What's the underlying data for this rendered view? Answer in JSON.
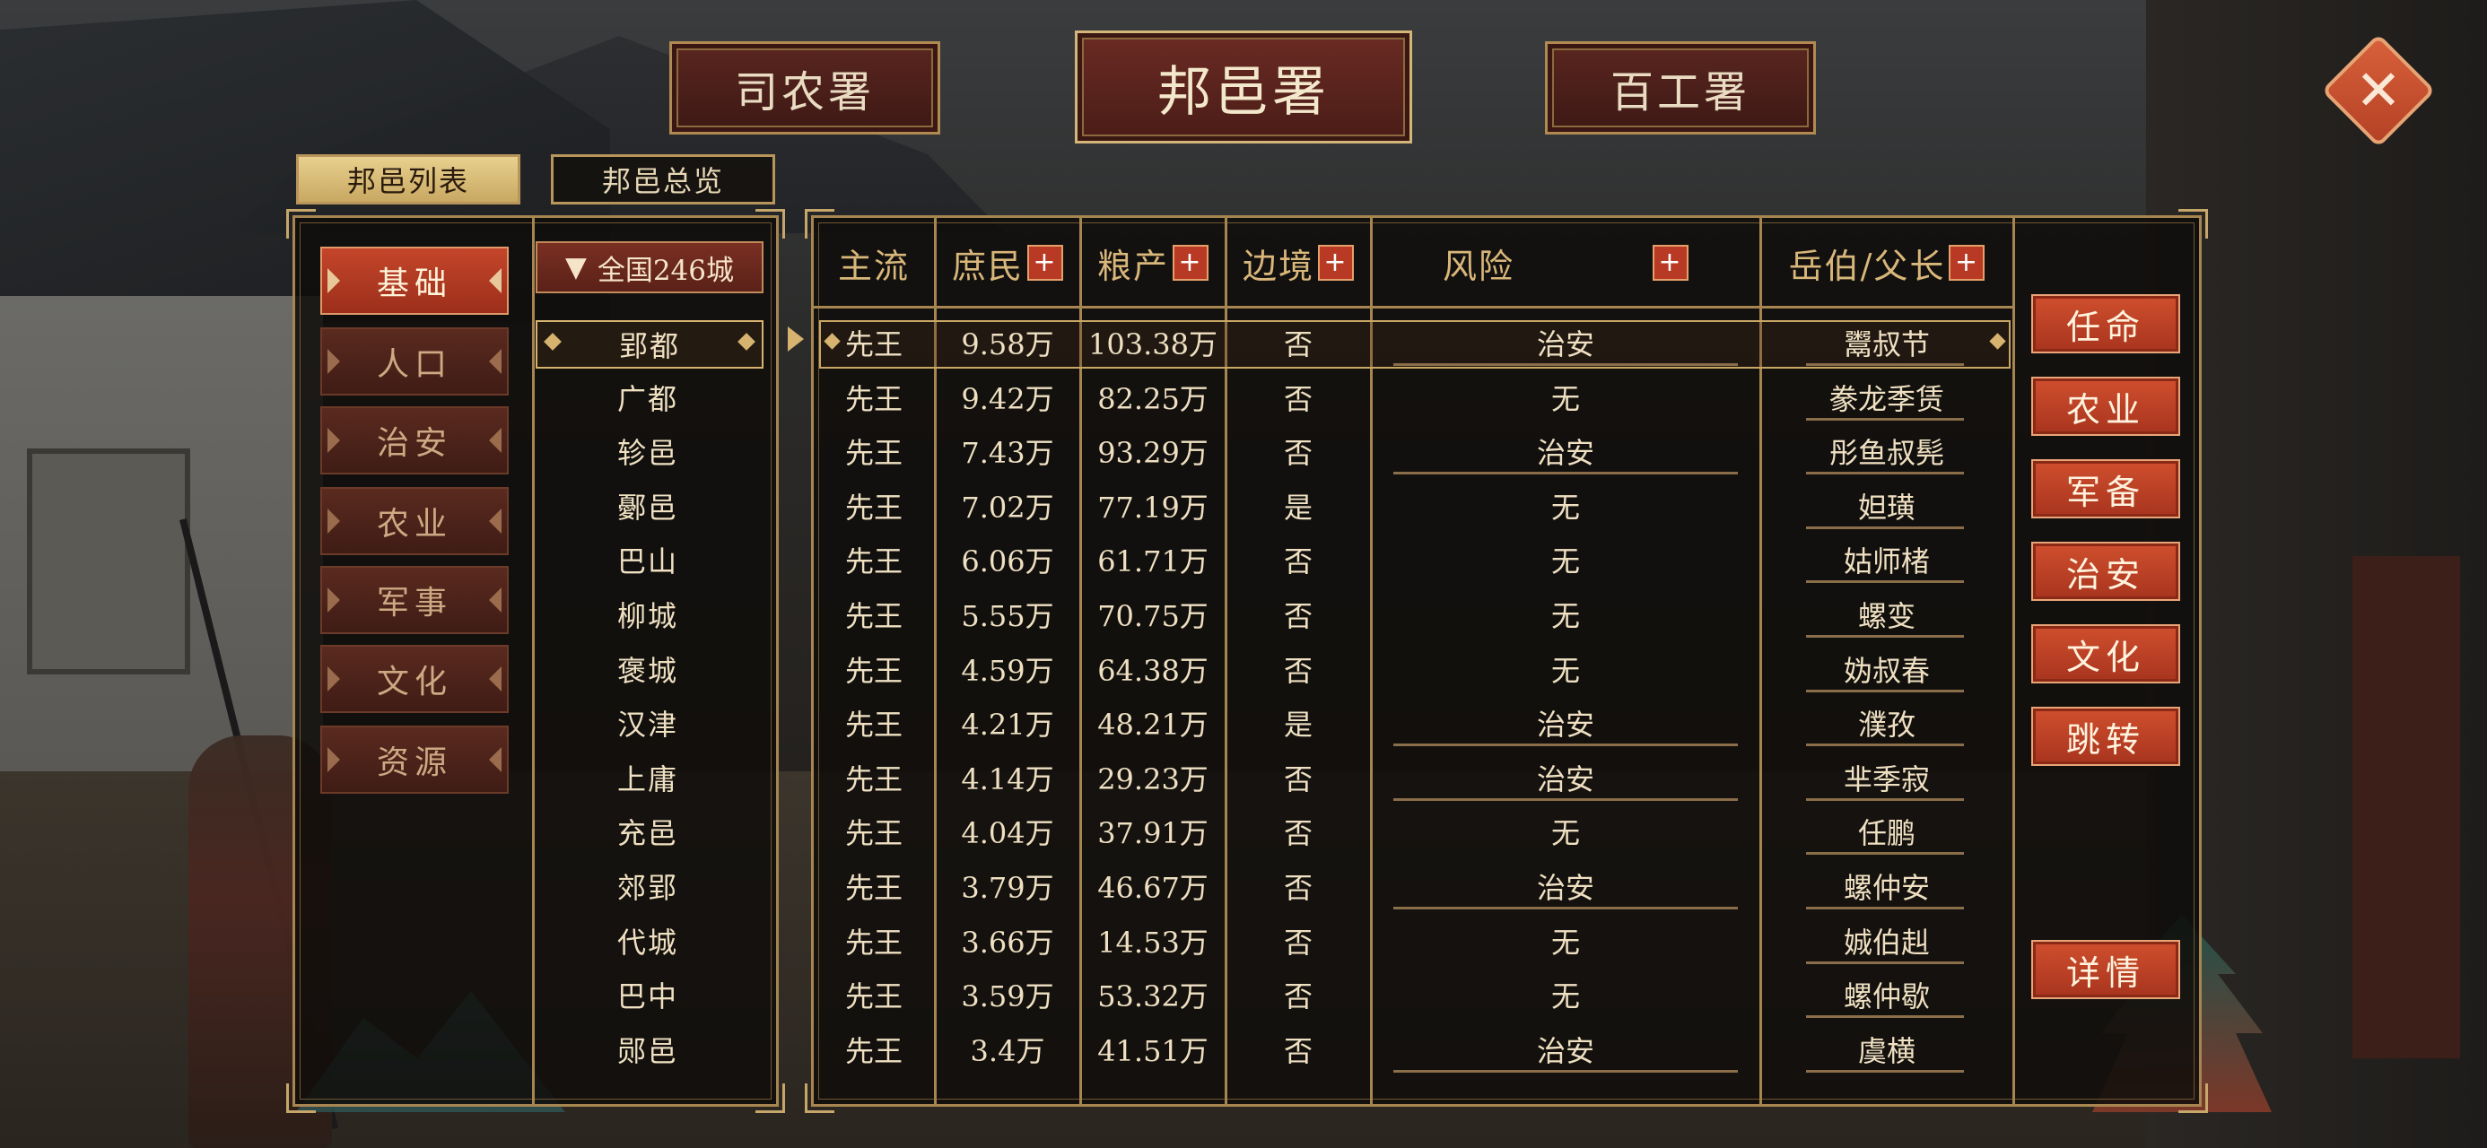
{
  "top_tabs": [
    "司农署",
    "邦邑署",
    "百工署"
  ],
  "active_top_tab": "邦邑署",
  "close_label": "✕",
  "sub_tabs": [
    "邦邑列表",
    "邦邑总览"
  ],
  "categories": [
    "基础",
    "人口",
    "治安",
    "农业",
    "军事",
    "文化",
    "资源"
  ],
  "filter": {
    "arrow": "▼",
    "label": "全国246城"
  },
  "headers": {
    "mainstream": "主流",
    "commoners": "庶民",
    "grain": "粮产",
    "border": "边境",
    "risk": "风险",
    "lord": "岳伯/父长",
    "plus": "+"
  },
  "rows": [
    {
      "city": "郢都",
      "mainstream": "先王",
      "commoners": "9.58万",
      "grain": "103.38万",
      "border": "否",
      "risk": "治安",
      "lord": "鬻叔节"
    },
    {
      "city": "广都",
      "mainstream": "先王",
      "commoners": "9.42万",
      "grain": "82.25万",
      "border": "否",
      "risk": "无",
      "lord": "豢龙季赁"
    },
    {
      "city": "轸邑",
      "mainstream": "先王",
      "commoners": "7.43万",
      "grain": "93.29万",
      "border": "否",
      "risk": "治安",
      "lord": "彤鱼叔髡"
    },
    {
      "city": "鄾邑",
      "mainstream": "先王",
      "commoners": "7.02万",
      "grain": "77.19万",
      "border": "是",
      "risk": "无",
      "lord": "妲璜"
    },
    {
      "city": "巴山",
      "mainstream": "先王",
      "commoners": "6.06万",
      "grain": "61.71万",
      "border": "否",
      "risk": "无",
      "lord": "姑师楮"
    },
    {
      "city": "柳城",
      "mainstream": "先王",
      "commoners": "5.55万",
      "grain": "70.75万",
      "border": "否",
      "risk": "无",
      "lord": "螺变"
    },
    {
      "city": "褒城",
      "mainstream": "先王",
      "commoners": "4.59万",
      "grain": "64.38万",
      "border": "否",
      "risk": "无",
      "lord": "妫叔春"
    },
    {
      "city": "汉津",
      "mainstream": "先王",
      "commoners": "4.21万",
      "grain": "48.21万",
      "border": "是",
      "risk": "治安",
      "lord": "濮孜"
    },
    {
      "city": "上庸",
      "mainstream": "先王",
      "commoners": "4.14万",
      "grain": "29.23万",
      "border": "否",
      "risk": "治安",
      "lord": "芈季寂"
    },
    {
      "city": "充邑",
      "mainstream": "先王",
      "commoners": "4.04万",
      "grain": "37.91万",
      "border": "否",
      "risk": "无",
      "lord": "任鹏"
    },
    {
      "city": "郊郢",
      "mainstream": "先王",
      "commoners": "3.79万",
      "grain": "46.67万",
      "border": "否",
      "risk": "治安",
      "lord": "螺仲安"
    },
    {
      "city": "代城",
      "mainstream": "先王",
      "commoners": "3.66万",
      "grain": "14.53万",
      "border": "否",
      "risk": "无",
      "lord": "娍伯赳"
    },
    {
      "city": "巴中",
      "mainstream": "先王",
      "commoners": "3.59万",
      "grain": "53.32万",
      "border": "否",
      "risk": "无",
      "lord": "螺仲歇"
    },
    {
      "city": "郧邑",
      "mainstream": "先王",
      "commoners": "3.4万",
      "grain": "41.51万",
      "border": "否",
      "risk": "治安",
      "lord": "虞横"
    }
  ],
  "selected_row": 0,
  "actions": [
    "任命",
    "农业",
    "军备",
    "治安",
    "文化",
    "跳转"
  ],
  "details_label": "详情",
  "colors": {
    "gold": "#a78550",
    "red_button": "#c4452a",
    "text": "#efe0c2",
    "header_text": "#d9b77a"
  }
}
